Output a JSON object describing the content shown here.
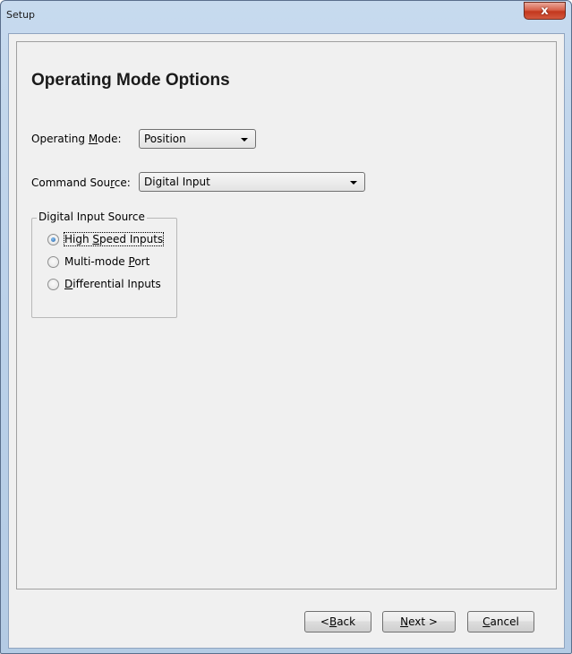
{
  "window": {
    "title": "Setup",
    "close_glyph": "x"
  },
  "page": {
    "title": "Operating Mode Options"
  },
  "operating_mode": {
    "label_pre": "Operating ",
    "label_mnemonic": "M",
    "label_post": "ode:",
    "value": "Position"
  },
  "command_source": {
    "label_pre": "Command Sou",
    "label_mnemonic": "r",
    "label_post": "ce:",
    "value": "Digital Input"
  },
  "digital_input_source": {
    "legend": "Digital Input Source",
    "options": [
      {
        "pre": "High ",
        "mnemonic": "S",
        "post": "peed Inputs",
        "checked": true
      },
      {
        "pre": "Multi-mode ",
        "mnemonic": "P",
        "post": "ort",
        "checked": false
      },
      {
        "pre": "",
        "mnemonic": "D",
        "post": "ifferential Inputs",
        "checked": false
      }
    ]
  },
  "buttons": {
    "back": {
      "pre": "< ",
      "mnemonic": "B",
      "post": "ack"
    },
    "next": {
      "pre": "",
      "mnemonic": "N",
      "post": "ext >"
    },
    "cancel": {
      "pre": "",
      "mnemonic": "C",
      "post": "ancel"
    }
  }
}
